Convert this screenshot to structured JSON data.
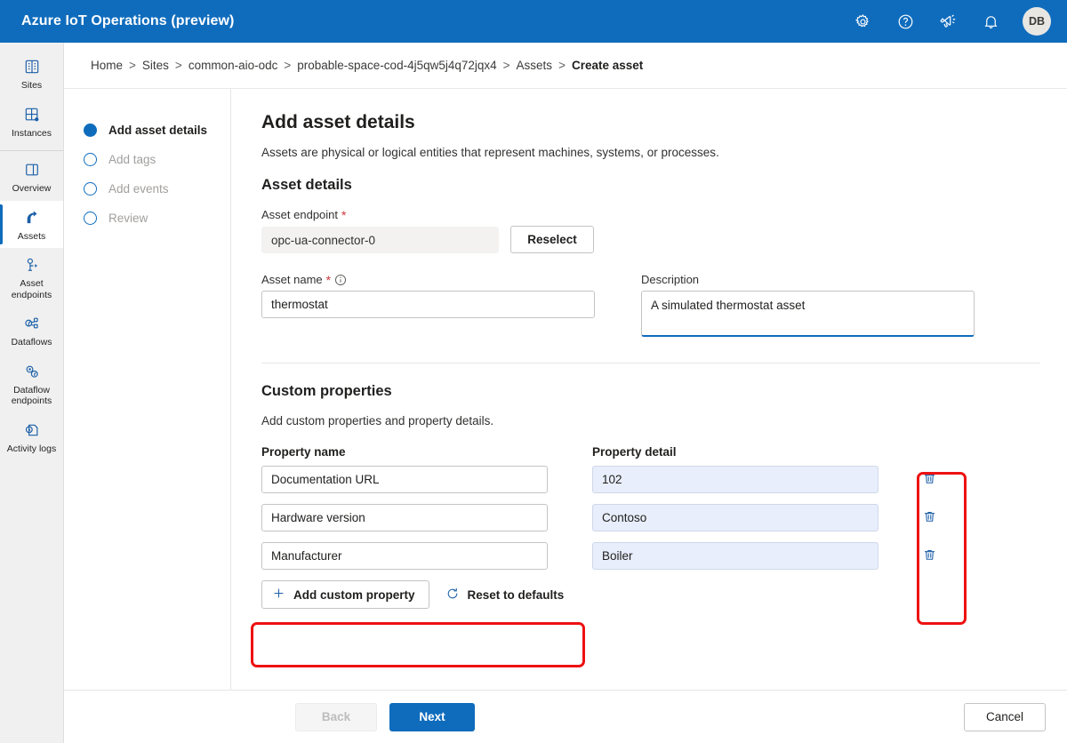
{
  "topbar": {
    "brand": "Azure IoT Operations (preview)",
    "icons": [
      {
        "name": "settings-icon",
        "label": "Settings"
      },
      {
        "name": "help-icon",
        "label": "Help"
      },
      {
        "name": "feedback-icon",
        "label": "Feedback"
      },
      {
        "name": "notifications-icon",
        "label": "Notifications"
      }
    ],
    "avatar_initials": "DB",
    "background_color": "#0f6cbd"
  },
  "rail": {
    "items": [
      {
        "label": "Sites",
        "icon": "sites-icon",
        "selected": false
      },
      {
        "label": "Instances",
        "icon": "instances-icon",
        "selected": false
      },
      {
        "label": "Overview",
        "icon": "overview-icon",
        "selected": false
      },
      {
        "label": "Assets",
        "icon": "assets-icon",
        "selected": true
      },
      {
        "label": "Asset endpoints",
        "icon": "asset-endpoints-icon",
        "selected": false
      },
      {
        "label": "Dataflows",
        "icon": "dataflows-icon",
        "selected": false
      },
      {
        "label": "Dataflow endpoints",
        "icon": "dataflow-endpoints-icon",
        "selected": false
      },
      {
        "label": "Activity logs",
        "icon": "activity-logs-icon",
        "selected": false
      }
    ],
    "accent_color": "#0f6cbd"
  },
  "breadcrumb": {
    "items": [
      "Home",
      "Sites",
      "common-aio-odc",
      "probable-space-cod-4j5qw5j4q72jqx4",
      "Assets"
    ],
    "current": "Create asset",
    "separator": ">"
  },
  "wizard": {
    "steps": [
      {
        "label": "Add asset details",
        "state": "active"
      },
      {
        "label": "Add tags",
        "state": "pending"
      },
      {
        "label": "Add events",
        "state": "pending"
      },
      {
        "label": "Review",
        "state": "pending"
      }
    ]
  },
  "main": {
    "title": "Add asset details",
    "subtitle": "Assets are physical or logical entities that represent machines, systems, or processes.",
    "asset_details": {
      "heading": "Asset details",
      "endpoint": {
        "label": "Asset endpoint",
        "required": true,
        "value": "opc-ua-connector-0",
        "placeholder": "",
        "disabled": true,
        "reselect_label": "Reselect"
      },
      "asset_name": {
        "label": "Asset name",
        "required": true,
        "has_info": true,
        "value": "thermostat",
        "placeholder": ""
      },
      "description": {
        "label": "Description",
        "required": false,
        "value": "A simulated thermostat asset",
        "placeholder": "",
        "focused": true
      }
    },
    "custom_properties": {
      "heading": "Custom properties",
      "subtitle": "Add custom properties and property details.",
      "columns": {
        "name": "Property name",
        "detail": "Property detail"
      },
      "rows": [
        {
          "name": "Documentation URL",
          "detail": "102"
        },
        {
          "name": "Hardware version",
          "detail": "Contoso"
        },
        {
          "name": "Manufacturer",
          "detail": "Boiler"
        }
      ],
      "delete_icon": "trash-icon",
      "add_label": "Add custom property",
      "add_icon": "plus-icon",
      "reset_label": "Reset to defaults",
      "reset_icon": "refresh-icon"
    }
  },
  "footer": {
    "back_label": "Back",
    "back_disabled": true,
    "next_label": "Next",
    "cancel_label": "Cancel"
  },
  "annotations": {
    "color": "#ee1111",
    "boxes": [
      {
        "name": "delete-column-highlight"
      },
      {
        "name": "property-actions-highlight"
      }
    ]
  }
}
